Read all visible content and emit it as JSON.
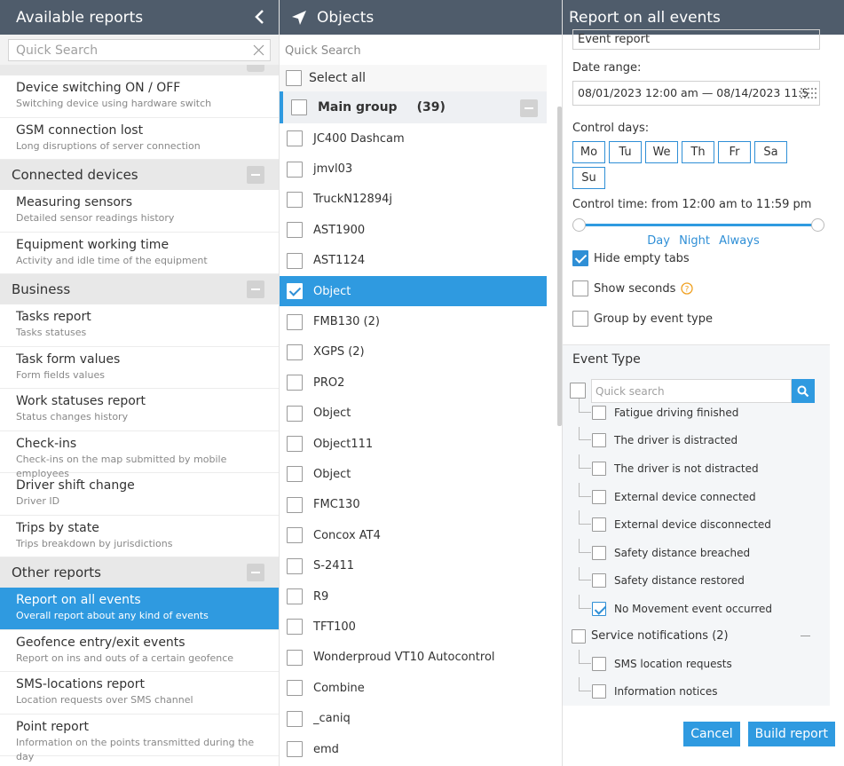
{
  "left": {
    "title": "Available reports",
    "search_placeholder": "Quick Search",
    "items_top": [
      {
        "title": "Device switching ON / OFF",
        "sub": "Switching device using hardware switch"
      },
      {
        "title": "GSM connection lost",
        "sub": "Long disruptions of server connection"
      }
    ],
    "groups": [
      {
        "name": "Connected devices",
        "items": [
          {
            "title": "Measuring sensors",
            "sub": "Detailed sensor readings history"
          },
          {
            "title": "Equipment working time",
            "sub": "Activity and idle time of the equipment"
          }
        ]
      },
      {
        "name": "Business",
        "items": [
          {
            "title": "Tasks report",
            "sub": "Tasks statuses"
          },
          {
            "title": "Task form values",
            "sub": "Form fields values"
          },
          {
            "title": "Work statuses report",
            "sub": "Status changes history"
          },
          {
            "title": "Check-ins",
            "sub": "Check-ins on the map submitted by mobile employees"
          },
          {
            "title": "Driver shift change",
            "sub": "Driver ID"
          },
          {
            "title": "Trips by state",
            "sub": "Trips breakdown by jurisdictions"
          }
        ]
      },
      {
        "name": "Other reports",
        "items": [
          {
            "title": "Report on all events",
            "sub": "Overall report about any kind of events"
          },
          {
            "title": "Geofence entry/exit events",
            "sub": "Report on ins and outs of a certain geofence"
          },
          {
            "title": "SMS-locations report",
            "sub": "Location requests over SMS channel"
          },
          {
            "title": "Point report",
            "sub": "Information on the points transmitted during the day"
          }
        ]
      }
    ]
  },
  "mid": {
    "title": "Objects",
    "search_placeholder": "Quick Search",
    "select_all": "Select all",
    "group_name": "Main group",
    "group_count": "(39)",
    "objects": [
      "JC400 Dashcam",
      "jmvl03",
      "TruckN12894j",
      "AST1900",
      "AST1124",
      "Object",
      "FMB130 (2)",
      "XGPS (2)",
      "PRO2",
      "Object",
      "Object111",
      "Object",
      "FMC130",
      "Concox AT4",
      "S-2411",
      "R9",
      "TFT100",
      "Wonderproud VT10 Autocontrol",
      "Combine",
      "_caniq",
      "emd"
    ]
  },
  "right": {
    "title": "Report on all events",
    "report_name": "Event report",
    "date_range_label": "Date range:",
    "date_range": "08/01/2023 12:00 am — 08/14/2023 11:5",
    "control_days_label": "Control days:",
    "days": [
      "Mo",
      "Tu",
      "We",
      "Th",
      "Fr",
      "Sa",
      "Su"
    ],
    "control_time": "Control time: from 12:00 am to 11:59 pm",
    "time_links": [
      "Day",
      "Night",
      "Always"
    ],
    "hide_empty": "Hide empty tabs",
    "show_seconds": "Show seconds",
    "group_by": "Group by event type",
    "event_type_title": "Event Type",
    "event_search_placeholder": "Quick search",
    "events": [
      {
        "label": "Fatigue driving finished",
        "checked": false
      },
      {
        "label": "The driver is distracted",
        "checked": false
      },
      {
        "label": "The driver is not distracted",
        "checked": false
      },
      {
        "label": "External device connected",
        "checked": false
      },
      {
        "label": "External device disconnected",
        "checked": false
      },
      {
        "label": "Safety distance breached",
        "checked": false
      },
      {
        "label": "Safety distance restored",
        "checked": false
      },
      {
        "label": "No Movement event occurred",
        "checked": true
      }
    ],
    "service_group": "Service notifications (2)",
    "service_items": [
      "SMS location requests",
      "Information notices"
    ],
    "cancel": "Cancel",
    "build": "Build report",
    "accent": "#2f9ae0"
  }
}
